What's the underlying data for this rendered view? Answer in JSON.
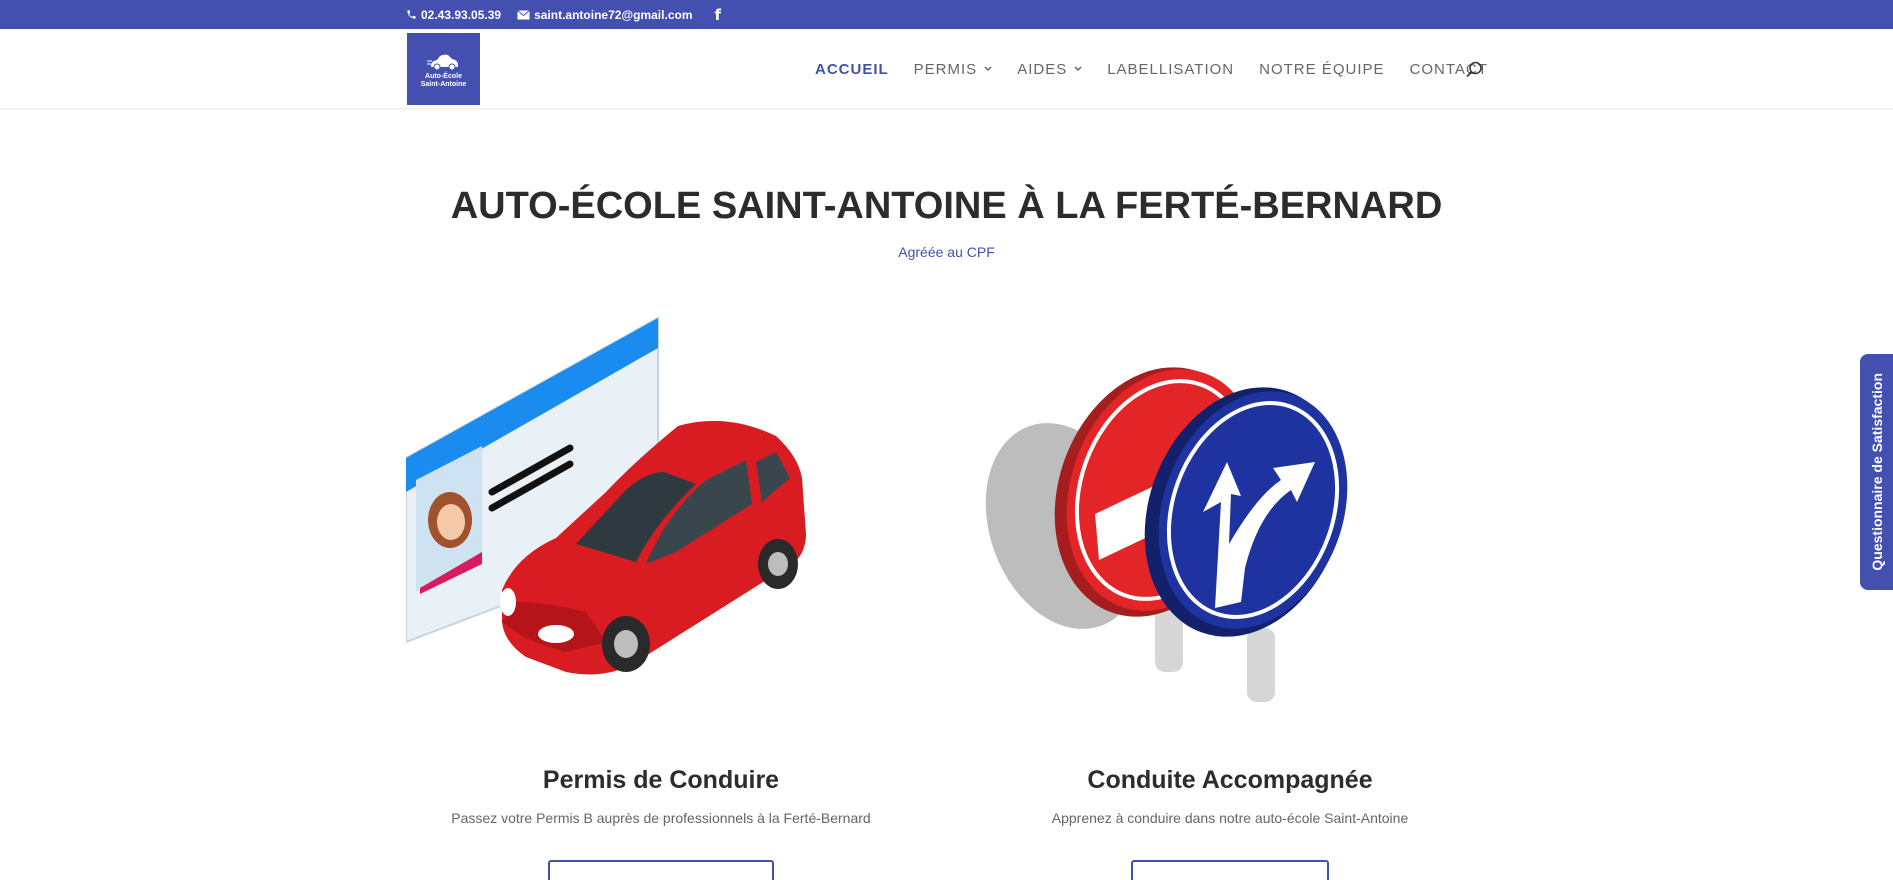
{
  "topbar": {
    "phone": "02.43.93.05.39",
    "email": "saint.antoine72@gmail.com",
    "social_icon": "facebook-icon"
  },
  "logo": {
    "line1": "Auto-École",
    "line2": "Saint-Antoine"
  },
  "nav": {
    "items": [
      {
        "label": "ACCUEIL",
        "active": true
      },
      {
        "label": "PERMIS",
        "dropdown": true
      },
      {
        "label": "AIDES",
        "dropdown": true
      },
      {
        "label": "LABELLISATION"
      },
      {
        "label": "NOTRE ÉQUIPE"
      },
      {
        "label": "CONTACT"
      }
    ],
    "search_icon": "search-icon"
  },
  "hero": {
    "title": "AUTO-ÉCOLE SAINT-ANTOINE À LA FERTÉ-BERNARD",
    "subtitle": "Agréée au CPF"
  },
  "cards": [
    {
      "title": "Permis de Conduire",
      "description": "Passez votre Permis B auprès de professionnels à la Ferté-Bernard"
    },
    {
      "title": "Conduite Accompagnée",
      "description": "Apprenez à conduire dans notre auto-école Saint-Antoine"
    }
  ],
  "side_tab": {
    "label": "Questionnaire de Satisfaction"
  },
  "colors": {
    "brand": "#4450b0",
    "text_dark": "#2c2c2c",
    "text_muted": "#666666"
  }
}
